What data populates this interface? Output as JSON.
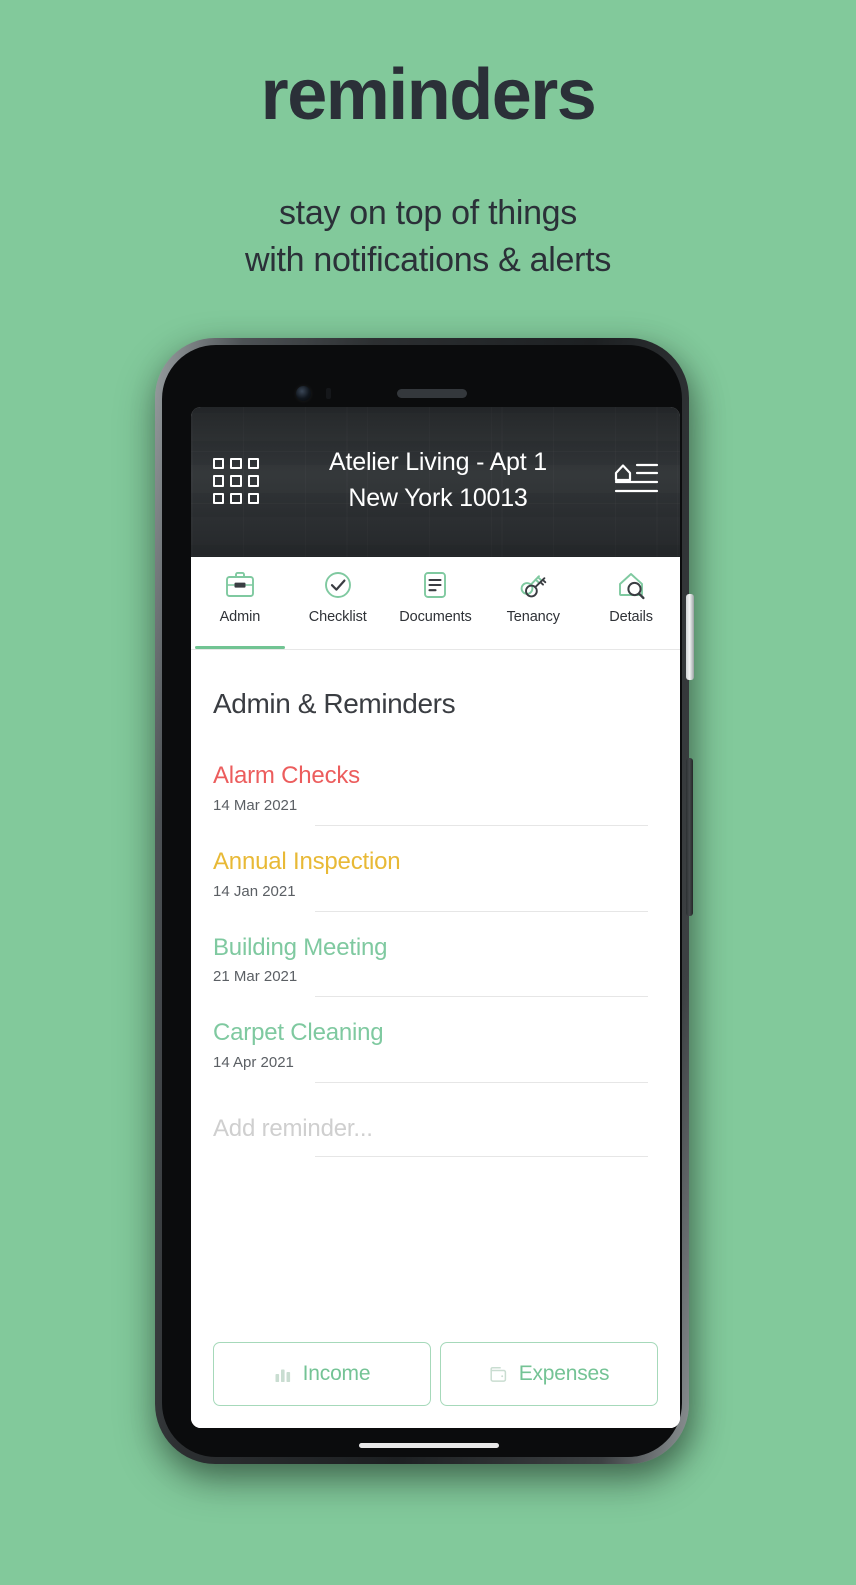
{
  "promo": {
    "title": "reminders",
    "subtitle_line1": "stay on top of things",
    "subtitle_line2": "with notifications & alerts"
  },
  "colors": {
    "background": "#82c99b",
    "accent_green": "#71c493",
    "mint": "#7fc9a0",
    "red": "#ec5d5d",
    "amber": "#e8b936",
    "dark_text": "#2b3038"
  },
  "app": {
    "header": {
      "grid_icon": "grid-3x3-icon",
      "title_line1": "Atelier Living - Apt 1",
      "title_line2": "New York 10013",
      "menu_icon": "property-list-icon"
    },
    "tabs": [
      {
        "label": "Admin",
        "icon": "briefcase-icon",
        "active": true
      },
      {
        "label": "Checklist",
        "icon": "check-circle-icon",
        "active": false
      },
      {
        "label": "Documents",
        "icon": "document-lines-icon",
        "active": false
      },
      {
        "label": "Tenancy",
        "icon": "keys-icon",
        "active": false
      },
      {
        "label": "Details",
        "icon": "house-search-icon",
        "active": false
      }
    ],
    "section_title": "Admin & Reminders",
    "reminders": [
      {
        "name": "Alarm Checks",
        "date": "14 Mar 2021",
        "color": "#ec5d5d"
      },
      {
        "name": "Annual Inspection",
        "date": "14 Jan 2021",
        "color": "#e8b936"
      },
      {
        "name": "Building Meeting",
        "date": "21 Mar 2021",
        "color": "#7fc9a0"
      },
      {
        "name": "Carpet Cleaning",
        "date": "14 Apr 2021",
        "color": "#7fc9a0"
      }
    ],
    "add_reminder_placeholder": "Add reminder...",
    "bottom_buttons": [
      {
        "label": "Income",
        "icon": "bar-chart-icon"
      },
      {
        "label": "Expenses",
        "icon": "wallet-icon"
      }
    ]
  }
}
